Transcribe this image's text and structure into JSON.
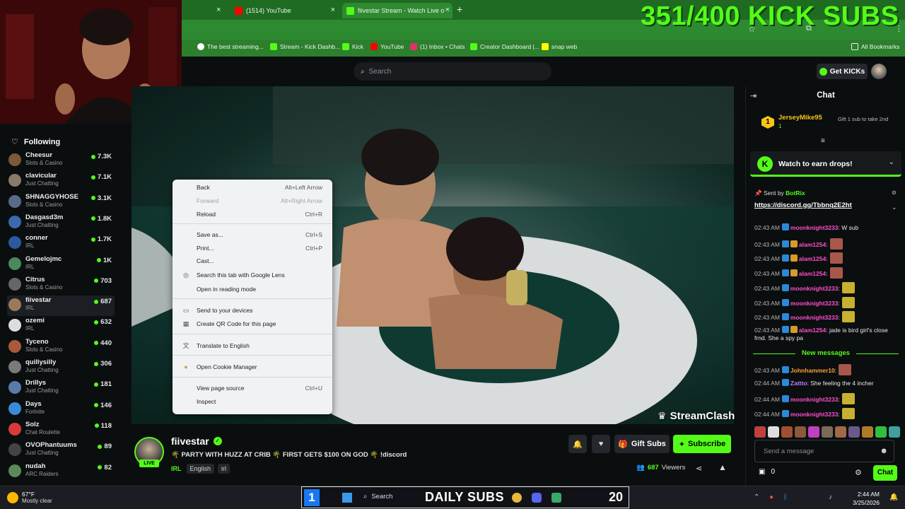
{
  "overlay": {
    "sub_goal": "351/400 KICK SUBS",
    "daily_subs_left": "1",
    "daily_subs_label": "DAILY SUBS",
    "daily_subs_right": "20"
  },
  "browser": {
    "tabs": [
      {
        "label": "(1514) YouTube"
      },
      {
        "label": "fiivestar Stream - Watch Live o"
      }
    ],
    "bookmarks": [
      {
        "label": "The best streaming..."
      },
      {
        "label": "Stream - Kick Dashb..."
      },
      {
        "label": "Kick"
      },
      {
        "label": "YouTube"
      },
      {
        "label": "(1) Inbox • Chats"
      },
      {
        "label": "Creator Dashboard |..."
      },
      {
        "label": "snap web"
      }
    ],
    "all_bookmarks": "All Bookmarks"
  },
  "header": {
    "search_placeholder": "Search",
    "get_kicks": "Get KICKs"
  },
  "sidebar": {
    "title": "Following",
    "channels": [
      {
        "name": "Cheesur",
        "category": "Slots & Casino",
        "viewers": "7.3K",
        "color": "#7a5a3a"
      },
      {
        "name": "clavicular",
        "category": "Just Chatting",
        "viewers": "7.1K",
        "color": "#8a7a6a"
      },
      {
        "name": "SHNAGGYHOSE",
        "category": "Slots & Casino",
        "viewers": "3.1K",
        "color": "#5a6a8a"
      },
      {
        "name": "Dasgasd3m",
        "category": "Just Chatting",
        "viewers": "1.8K",
        "color": "#3a6aaa"
      },
      {
        "name": "conner",
        "category": "IRL",
        "viewers": "1.7K",
        "color": "#2a5a9a"
      },
      {
        "name": "Gemelojmc",
        "category": "IRL",
        "viewers": "1K",
        "color": "#4a8a5a"
      },
      {
        "name": "Citrus",
        "category": "Slots & Casino",
        "viewers": "703",
        "color": "#666"
      },
      {
        "name": "fiivestar",
        "category": "IRL",
        "viewers": "687",
        "color": "#9a7a5a"
      },
      {
        "name": "ozemi",
        "category": "IRL",
        "viewers": "632",
        "color": "#ddd"
      },
      {
        "name": "Tyceno",
        "category": "Slots & Casino",
        "viewers": "440",
        "color": "#aa5a3a"
      },
      {
        "name": "quillysilly",
        "category": "Just Chatting",
        "viewers": "306",
        "color": "#7a7a7a"
      },
      {
        "name": "Drillys",
        "category": "Just Chatting",
        "viewers": "181",
        "color": "#5a7aaa"
      },
      {
        "name": "Days",
        "category": "Fortnite",
        "viewers": "146",
        "color": "#3a8ada"
      },
      {
        "name": "Solz",
        "category": "Chat Roulette",
        "viewers": "118",
        "color": "#d83a3a"
      },
      {
        "name": "OVOPhantuums",
        "category": "Just Chatting",
        "viewers": "89",
        "color": "#444"
      },
      {
        "name": "nudah",
        "category": "ARC Raiders",
        "viewers": "82",
        "color": "#5a8a5a"
      }
    ]
  },
  "context_menu": {
    "items": [
      {
        "label": "Back",
        "shortcut": "Alt+Left Arrow"
      },
      {
        "label": "Forward",
        "shortcut": "Alt+Right Arrow"
      },
      {
        "label": "Reload",
        "shortcut": "Ctrl+R"
      },
      {
        "label": "Save as...",
        "shortcut": "Ctrl+S"
      },
      {
        "label": "Print...",
        "shortcut": "Ctrl+P"
      },
      {
        "label": "Cast...",
        "shortcut": ""
      },
      {
        "label": "Search this tab with Google Lens",
        "shortcut": ""
      },
      {
        "label": "Open in reading mode",
        "shortcut": ""
      },
      {
        "label": "Send to your devices",
        "shortcut": ""
      },
      {
        "label": "Create QR Code for this page",
        "shortcut": ""
      },
      {
        "label": "Translate to English",
        "shortcut": ""
      },
      {
        "label": "Open Cookie Manager",
        "shortcut": ""
      },
      {
        "label": "View page source",
        "shortcut": "Ctrl+U"
      },
      {
        "label": "Inspect",
        "shortcut": ""
      }
    ]
  },
  "video": {
    "watermark": "StreamClash"
  },
  "stream": {
    "live": "LIVE",
    "name": "fiivestar",
    "title": "🌴 PARTY WITH HUZZ AT CRIB 🌴 FIRST GETS $100 ON GOD 🌴 !discord",
    "category": "IRL",
    "tags": [
      "English",
      "irl"
    ],
    "gift_subs": "Gift Subs",
    "subscribe": "Subscribe",
    "viewers_count": "687",
    "viewers_label": "Viewers"
  },
  "chat": {
    "title": "Chat",
    "pinned_gift": {
      "rank": "1",
      "user": "JerseyMike95",
      "count": "1",
      "action": "Gift 1 sub to take 2nd"
    },
    "drops_label": "Watch to earn drops!",
    "pinned": {
      "sent_by_label": "Sent by",
      "sender": "BotRix",
      "link": "https://discord.gg/Tbbnq2E2ht"
    },
    "messages_before": [
      {
        "time": "02:43 AM",
        "user": "moonknight3233",
        "text": ": W sub",
        "user_class": "u-pink",
        "emote": ""
      },
      {
        "time": "02:43 AM",
        "user": "alam1254",
        "text": ":",
        "user_class": "u-pink",
        "emote": "#a8584a"
      },
      {
        "time": "02:43 AM",
        "user": "alam1254",
        "text": ":",
        "user_class": "u-pink",
        "emote": "#a8584a"
      },
      {
        "time": "02:43 AM",
        "user": "alam1254",
        "text": ":",
        "user_class": "u-pink",
        "emote": "#a8584a"
      },
      {
        "time": "02:43 AM",
        "user": "moonknight3233",
        "text": ":",
        "user_class": "u-pink",
        "emote": "#c8b030"
      },
      {
        "time": "02:43 AM",
        "user": "moonknight3233",
        "text": ":",
        "user_class": "u-pink",
        "emote": "#c8b030"
      },
      {
        "time": "02:43 AM",
        "user": "moonknight3233",
        "text": ":",
        "user_class": "u-pink",
        "emote": "#c8b030"
      },
      {
        "time": "02:43 AM",
        "user": "alam1254",
        "text": ": jade is bird girl's close frnd. She a spy pa",
        "user_class": "u-pink",
        "emote": ""
      }
    ],
    "new_messages": "New messages",
    "messages_after": [
      {
        "time": "02:43 AM",
        "user": "Johnhammer10",
        "text": ":",
        "user_class": "u-orange",
        "emote": "#a8584a"
      },
      {
        "time": "02:44 AM",
        "user": "Zattto",
        "text": ": She feeling the 4 incher",
        "user_class": "u-purple",
        "emote": ""
      },
      {
        "time": "02:44 AM",
        "user": "moonknight3233",
        "text": ":",
        "user_class": "u-pink",
        "emote": "#c8b030"
      },
      {
        "time": "02:44 AM",
        "user": "moonknight3233",
        "text": ":",
        "user_class": "u-pink",
        "emote": "#c8b030"
      }
    ],
    "input_placeholder": "Send a message",
    "kicks_count": "0",
    "send": "Chat"
  },
  "taskbar": {
    "temperature": "67°F",
    "weather": "Mostly clear",
    "search": "Search",
    "time": "2:44 AM",
    "date": "3/25/2026"
  }
}
